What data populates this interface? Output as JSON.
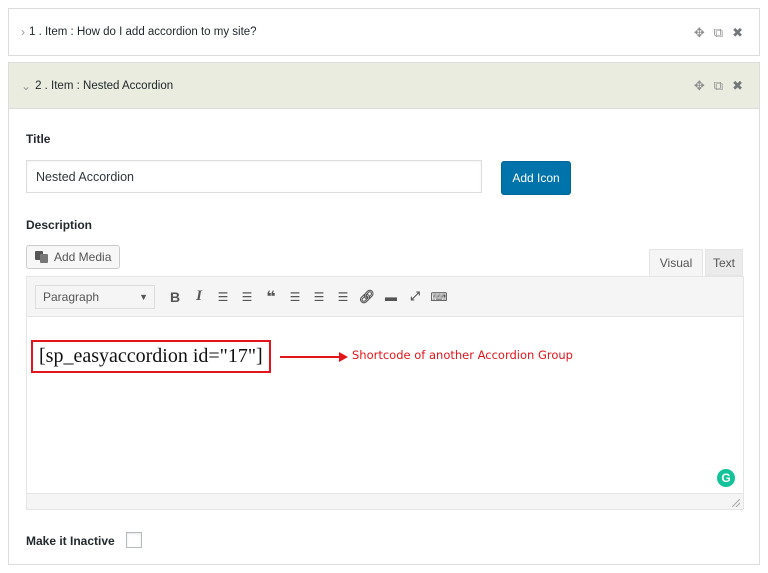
{
  "items": [
    {
      "number": "1",
      "label": "Item",
      "title": "How do I add accordion to my site?",
      "expanded": false
    },
    {
      "number": "2",
      "label": "Item",
      "title": "Nested Accordion",
      "expanded": true
    }
  ],
  "header_icons": [
    "move-icon",
    "duplicate-icon",
    "close-icon"
  ],
  "item1": {
    "prefix": "1 .  Item :",
    "title": "How do I add accordion to my site?"
  },
  "item2": {
    "prefix": "2 .  Item :",
    "title": "Nested Accordion"
  },
  "form": {
    "title_label": "Title",
    "title_value": "Nested Accordion",
    "add_icon_label": "Add Icon",
    "description_label": "Description",
    "add_media_label": "Add Media",
    "tab_visual": "Visual",
    "tab_text": "Text",
    "format_select": "Paragraph",
    "make_inactive_label": "Make it Inactive",
    "make_inactive_checked": false
  },
  "editor": {
    "content": "[sp_easyaccordion id=\"17\"]",
    "annotation": "Shortcode of another Accordion Group",
    "toolbar_buttons": [
      "bold",
      "italic",
      "bulleted-list",
      "numbered-list",
      "blockquote",
      "align-left",
      "align-center",
      "align-right",
      "link",
      "read-more",
      "fullscreen",
      "toolbar-toggle"
    ]
  },
  "colors": {
    "expanded_header_bg": "#e9ecdf",
    "primary_button": "#0073aa",
    "annotation_red": "#e3151a",
    "grammarly_green": "#15c39a"
  }
}
